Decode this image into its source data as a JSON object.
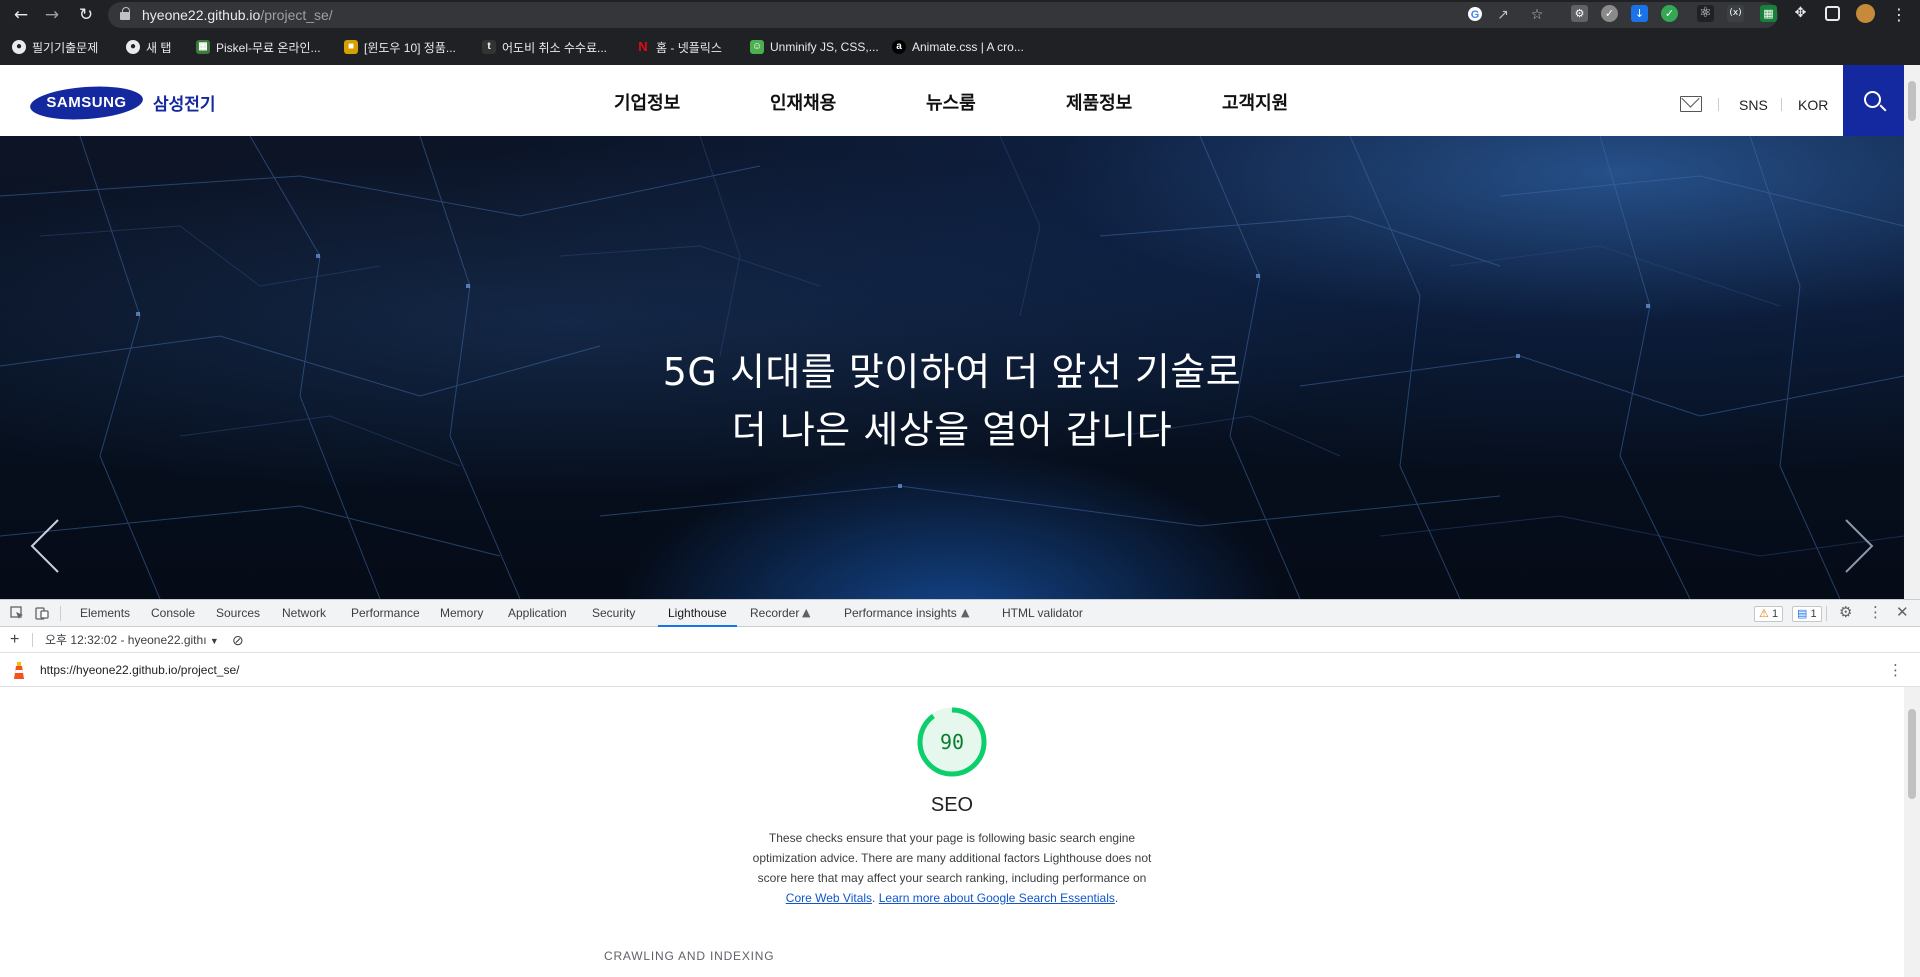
{
  "browser": {
    "url_host": "hyeone22.github.io",
    "url_path": "/project_se/",
    "bookmarks": [
      {
        "label": "필기기출문제",
        "icon": "globe-icon",
        "color": "#5f6368"
      },
      {
        "label": "새 탭",
        "icon": "globe-icon",
        "color": "#5f6368"
      },
      {
        "label": "Piskel-무료 온라인...",
        "icon": "piskel-icon",
        "color": "#3d7b3d"
      },
      {
        "label": "[윈도우 10] 정품...",
        "icon": "windows-icon",
        "color": "#d5a100"
      },
      {
        "label": "어도비 취소 수수료...",
        "icon": "tistory-icon",
        "color": "#333333"
      },
      {
        "label": "홈 - 넷플릭스",
        "icon": "netflix-icon",
        "color": "#e50914"
      },
      {
        "label": "Unminify JS, CSS,...",
        "icon": "unminify-icon",
        "color": "#4caf50"
      },
      {
        "label": "Animate.css | A cro...",
        "icon": "animate-icon",
        "color": "#000000"
      }
    ]
  },
  "site": {
    "logo_text": "SAMSUNG",
    "logo_sub": "삼성전기",
    "nav": [
      "기업정보",
      "인재채용",
      "뉴스룸",
      "제품정보",
      "고객지원"
    ],
    "links": {
      "sns": "SNS",
      "lang": "KOR"
    },
    "hero_line1": "5G 시대를 맞이하여 더 앞선 기술로",
    "hero_line2": "더 나은 세상을 열어 갑니다",
    "brand_color": "#1428a0"
  },
  "devtools": {
    "tabs": [
      "Elements",
      "Console",
      "Sources",
      "Network",
      "Performance",
      "Memory",
      "Application",
      "Security",
      "Lighthouse",
      "Recorder",
      "Performance insights",
      "HTML validator"
    ],
    "active_tab": "Lighthouse",
    "warnings_count": "1",
    "messages_count": "1",
    "report_selector": "오후 12:32:02 - hyeone22.githı",
    "report_url": "https://hyeone22.github.io/project_se/",
    "score": "90",
    "score_fraction": 0.9,
    "score_color": "#0cce6b",
    "category": "SEO",
    "desc_text": "These checks ensure that your page is following basic search engine optimization advice. There are many additional factors Lighthouse does not score here that may affect your search ranking, including performance on",
    "link_cwv": "Core Web Vitals",
    "link_learn": "Learn more about Google Search Essentials",
    "group_title": "CRAWLING AND INDEXING"
  }
}
